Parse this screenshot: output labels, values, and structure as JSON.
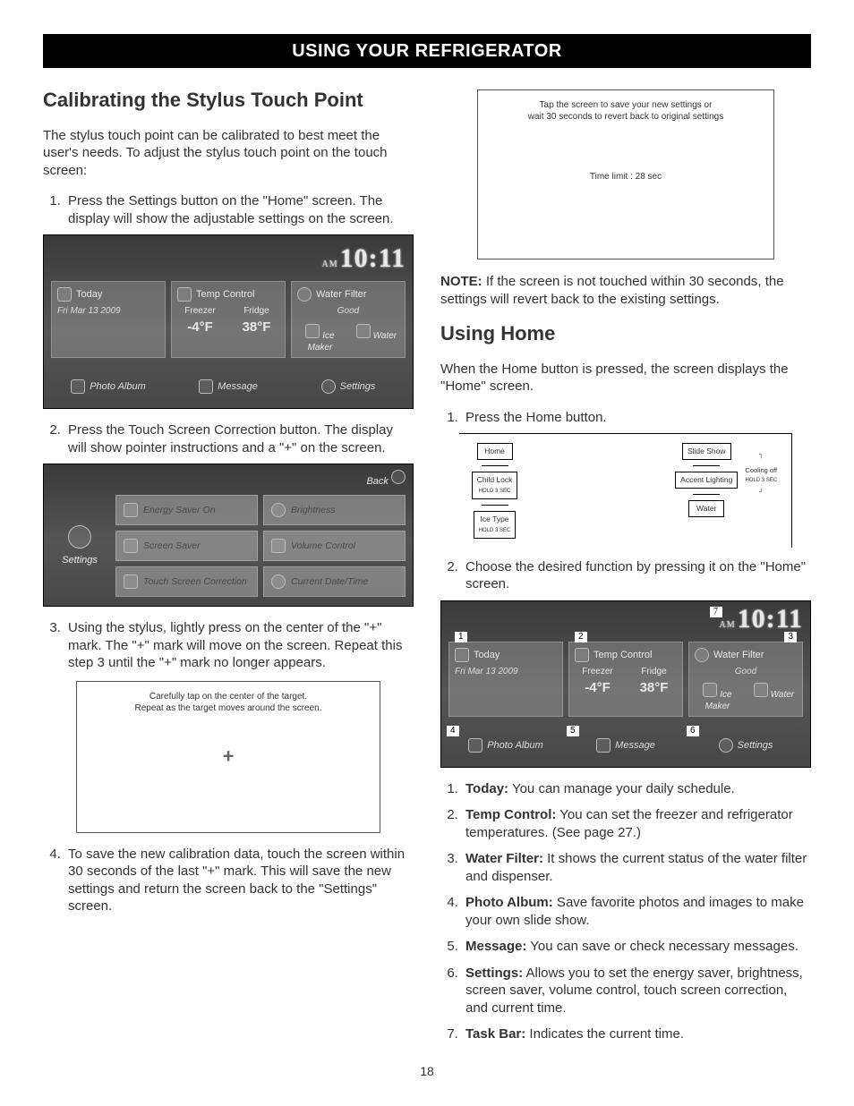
{
  "banner": "USING YOUR REFRIGERATOR",
  "page_number": "18",
  "left": {
    "h_calibrate": "Calibrating the Stylus Touch Point",
    "intro": "The stylus touch point can be calibrated to best meet the user's needs. To adjust the stylus touch point on the touch screen:",
    "steps": {
      "s1": "Press the Settings button on the \"Home\" screen. The display will show the adjustable settings on the screen.",
      "s2": "Press the Touch Screen Correction button. The display will show pointer instructions and a \"+\" on the screen.",
      "s3": "Using the stylus, lightly press on the center of the \"+\" mark. The \"+\" mark will move on the screen. Repeat this step 3 until the \"+\" mark no longer appears.",
      "s4": "To save the new calibration data, touch the screen within 30 seconds of the last \"+\" mark. This will save the new settings and return the screen back to the \"Settings\" screen."
    },
    "screen_home": {
      "clock_am": "AM",
      "clock_time": "10:11",
      "today": "Today",
      "date": "Fri Mar 13 2009",
      "temp_control": "Temp Control",
      "freezer_label": "Freezer",
      "fridge_label": "Fridge",
      "freezer_temp": "-4°F",
      "fridge_temp": "38°F",
      "water_filter": "Water Filter",
      "filter_status": "Good",
      "ice_maker": "Ice Maker",
      "water": "Water",
      "photo_album": "Photo Album",
      "message": "Message",
      "settings": "Settings"
    },
    "screen_settings": {
      "back": "Back",
      "settings": "Settings",
      "energy_saver": "Energy Saver On",
      "brightness": "Brightness",
      "screen_saver": "Screen Saver",
      "volume": "Volume Control",
      "touch_correction": "Touch Screen Correction",
      "datetime": "Current Date/Time"
    },
    "calib_box": {
      "line1": "Carefully tap on the center of the target.",
      "line2": "Repeat as the target moves around the screen."
    }
  },
  "right": {
    "save_box": {
      "line1": "Tap the screen to save your new settings or",
      "line2": "wait 30 seconds to revert back to original settings",
      "timer": "Time limit : 28 sec"
    },
    "note_label": "NOTE:",
    "note": " If the screen is not touched within 30 seconds, the settings will revert back to the existing settings.",
    "h_home": "Using Home",
    "home_intro": "When the Home button is pressed, the screen displays the \"Home\" screen.",
    "home_step1": "Press the Home button.",
    "panel": {
      "home": "Home",
      "child_lock": "Child Lock",
      "child_lock_sub": "HOLD 3 SEC",
      "ice_type": "Ice Type",
      "ice_type_sub": "HOLD 3 SEC",
      "slide_show": "Slide Show",
      "accent": "Accent Lighting",
      "water": "Water",
      "cooling_off": "Cooling off",
      "cooling_off_sub": "HOLD 3 SEC"
    },
    "home_step2": "Choose the desired function by pressing it on the \"Home\" screen.",
    "nums": {
      "n1": "1",
      "n2": "2",
      "n3": "3",
      "n4": "4",
      "n5": "5",
      "n6": "6",
      "n7": "7"
    },
    "desc": {
      "d1_t": "Today:",
      "d1": " You can manage your daily schedule.",
      "d2_t": "Temp Control:",
      "d2": " You can set the freezer and refrigerator temperatures. (See page 27.)",
      "d3_t": "Water Filter:",
      "d3": " It shows the current status of the water filter and dispenser.",
      "d4_t": "Photo Album:",
      "d4": " Save favorite photos and images to make your own slide show.",
      "d5_t": "Message:",
      "d5": " You can save or check necessary messages.",
      "d6_t": "Settings:",
      "d6": " Allows you to set the energy saver, brightness, screen saver, volume control, touch screen correction, and current time.",
      "d7_t": "Task Bar:",
      "d7": " Indicates the current time."
    }
  }
}
